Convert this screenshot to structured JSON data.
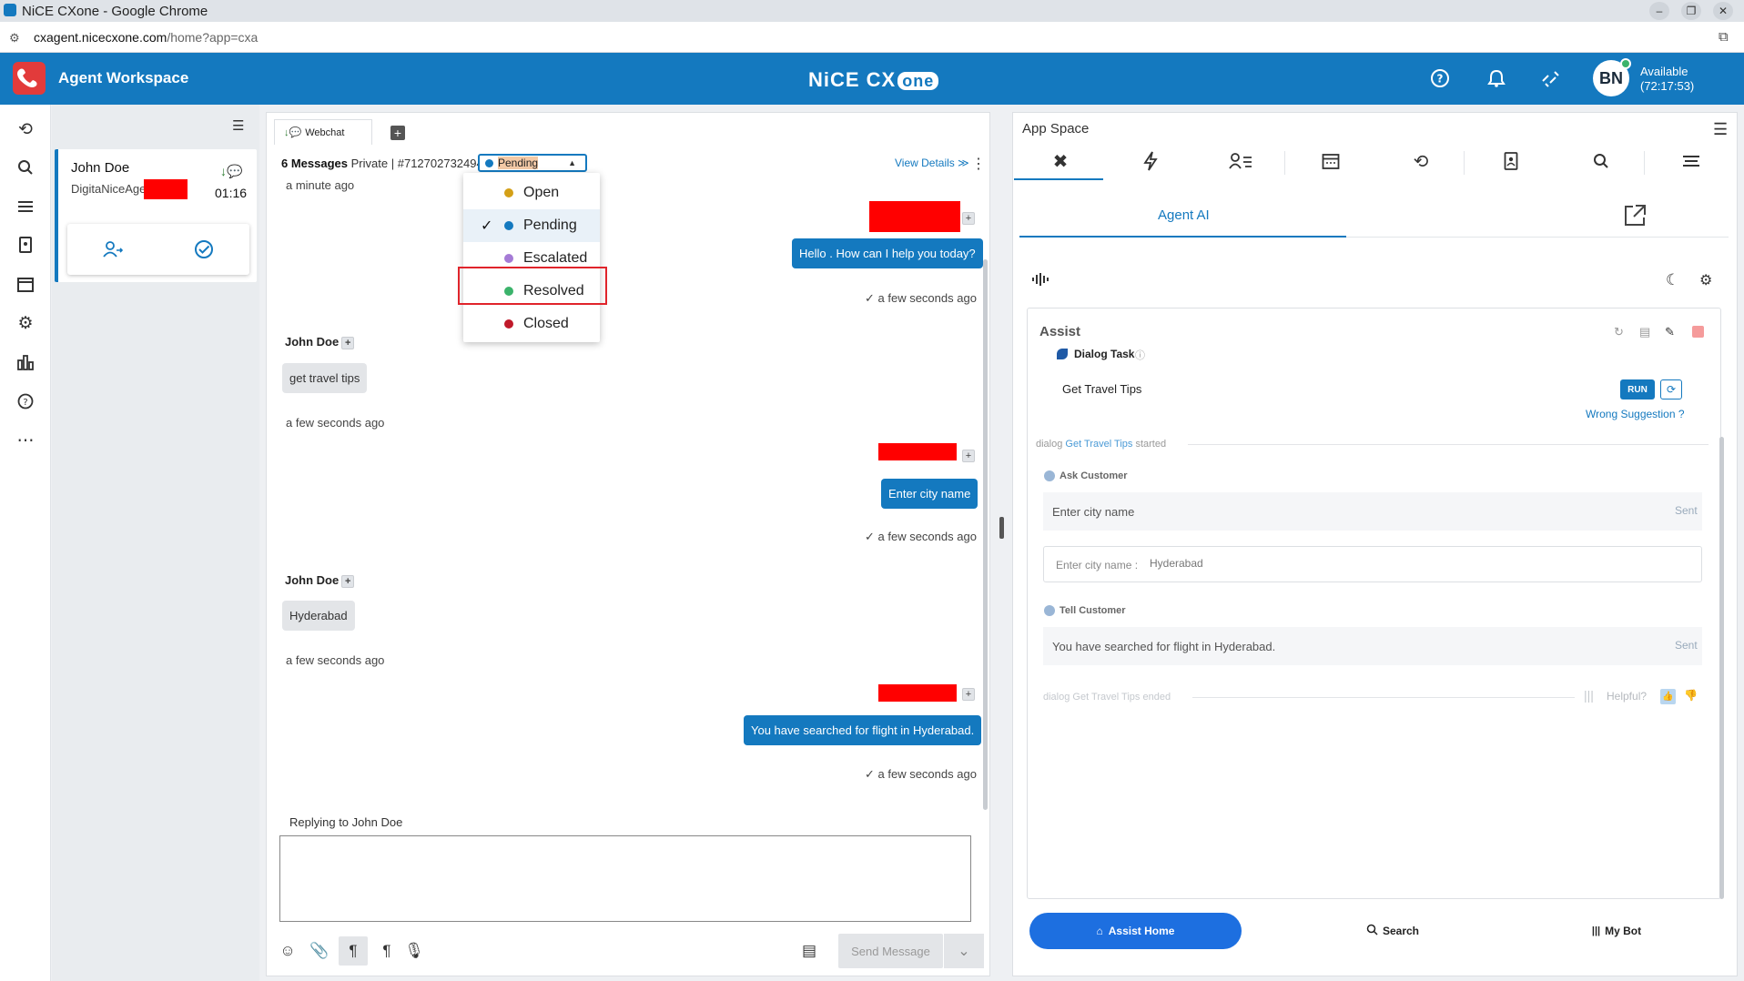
{
  "browser": {
    "window_title": "NiCE CXone - Google Chrome",
    "url_host": "cxagent.nicecxone.com",
    "url_path": "/home?app=cxa"
  },
  "header": {
    "app_title": "Agent Workspace",
    "brand_main": "NiCE CX",
    "brand_one": "one",
    "avatar_initials": "BN",
    "status": "Available",
    "status_timer": "(72:17:53)"
  },
  "contact_card": {
    "name": "John Doe",
    "sub": "DigitaNiceAgent",
    "time": "01:16"
  },
  "conversation": {
    "tab_label": "Webchat",
    "meta_count": "6 Messages",
    "meta_private": "Private",
    "meta_sep": "|",
    "meta_id": "#712702732494",
    "status_value": "Pending",
    "view_details": "View Details",
    "messages": {
      "t0": "a minute ago",
      "agent1": "Hello . How can I help you today?",
      "t1": "a few seconds ago",
      "sender1": "John Doe",
      "cust1": "get travel tips",
      "t2": "a few seconds ago",
      "agent2": "Enter city name",
      "t3": "a few seconds ago",
      "sender2": "John Doe",
      "cust2": "Hyderabad",
      "t4": "a few seconds ago",
      "agent3": "You have searched for flight in Hyderabad.",
      "t5": "a few seconds ago"
    },
    "reply_label": "Replying to John Doe",
    "send_label": "Send Message"
  },
  "status_dropdown": {
    "options": [
      "Open",
      "Pending",
      "Escalated",
      "Resolved",
      "Closed"
    ],
    "colors": [
      "#d4a017",
      "#1479bf",
      "#a57bd6",
      "#3bb36b",
      "#c0192a"
    ],
    "selected": "Pending",
    "highlighted": "Resolved"
  },
  "app_space": {
    "title": "App Space",
    "agent_ai_tab": "Agent AI",
    "assist_title": "Assist",
    "task_label": "Dialog Task",
    "task_name": "Get Travel Tips",
    "run_label": "RUN",
    "wrong_suggestion": "Wrong Suggestion ?",
    "log_started_pre": "dialog",
    "log_started_name": "Get Travel Tips",
    "log_started_post": "started",
    "ask_label": "Ask Customer",
    "ask_text": "Enter city name",
    "sent1": "Sent",
    "input_label": "Enter city name :",
    "input_value": "Hyderabad",
    "tell_label": "Tell Customer",
    "tell_text": "You have searched for flight in Hyderabad.",
    "sent2": "Sent",
    "log_ended_pre": "dialog",
    "log_ended_name": "Get Travel Tips",
    "log_ended_post": "ended",
    "helpful": "Helpful?",
    "bottom_nav": {
      "assist_home": "Assist Home",
      "search": "Search",
      "my_bot": "My Bot"
    }
  },
  "colors": {
    "brand_blue": "#1479bf",
    "redaction": "#ff0000",
    "highlight_border": "#e0242b"
  }
}
